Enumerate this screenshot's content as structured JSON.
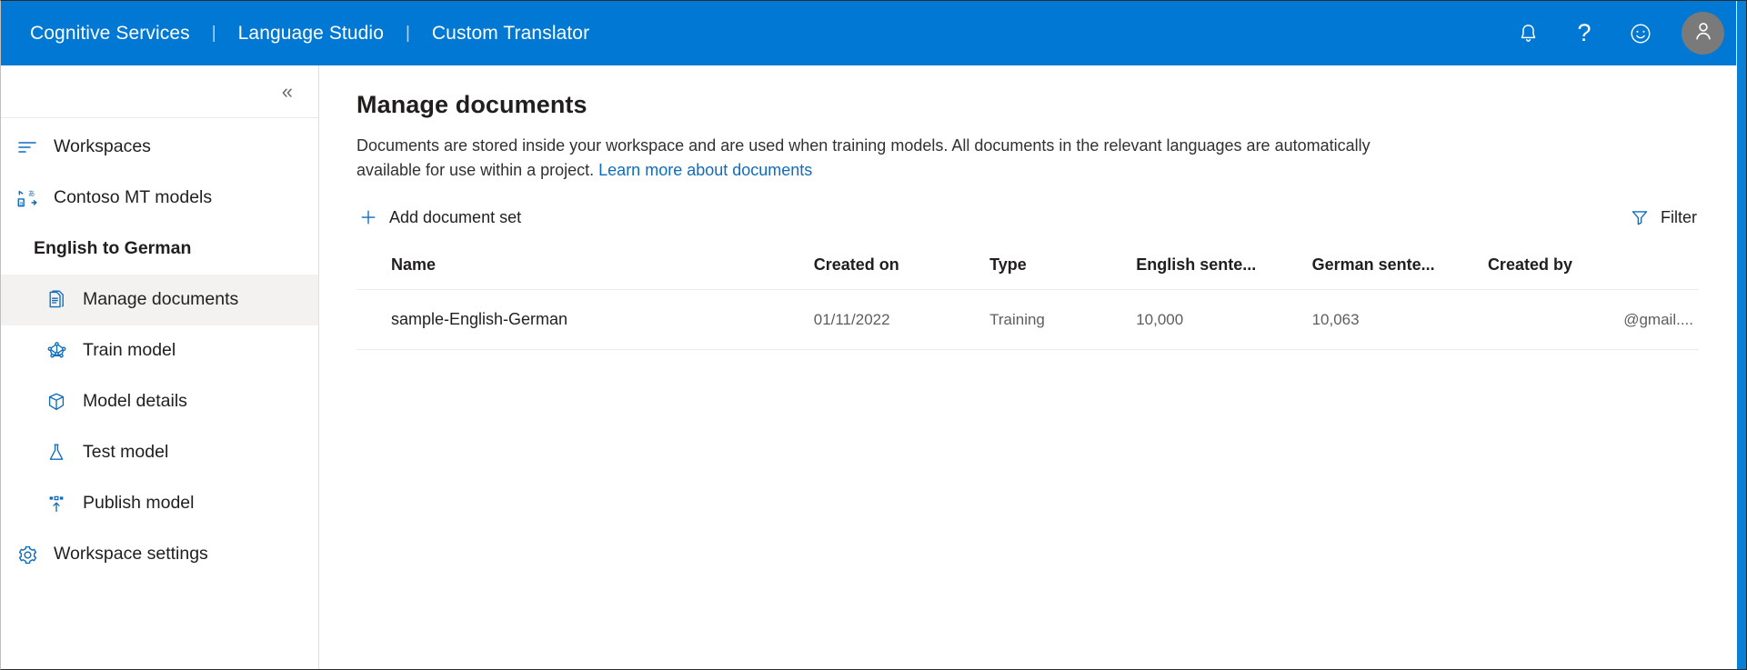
{
  "header": {
    "brand_items": [
      {
        "label": "Cognitive Services"
      },
      {
        "label": "Language Studio"
      },
      {
        "label": "Custom Translator"
      }
    ],
    "separator": "|",
    "icons": {
      "notifications": "bell-icon",
      "help": "?",
      "feedback": "smiley-icon",
      "account": "person-icon"
    },
    "colors": {
      "bar": "#0078d4",
      "text": "#ffffff",
      "avatar": "#7a7a7a"
    }
  },
  "sidebar": {
    "collapse_glyph": "«",
    "items": [
      {
        "label": "Workspaces",
        "icon": "list-icon",
        "level": "top",
        "selected": false
      },
      {
        "label": "Contoso MT models",
        "icon": "translate-icon",
        "level": "top",
        "selected": false
      },
      {
        "label": "English to German",
        "icon": "",
        "level": "group",
        "selected": false
      },
      {
        "label": "Manage documents",
        "icon": "document-icon",
        "level": "sub",
        "selected": true
      },
      {
        "label": "Train model",
        "icon": "network-icon",
        "level": "sub",
        "selected": false
      },
      {
        "label": "Model details",
        "icon": "package-icon",
        "level": "sub",
        "selected": false
      },
      {
        "label": "Test model",
        "icon": "flask-icon",
        "level": "sub",
        "selected": false
      },
      {
        "label": "Publish model",
        "icon": "publish-icon",
        "level": "sub",
        "selected": false
      },
      {
        "label": "Workspace settings",
        "icon": "gear-icon",
        "level": "top",
        "selected": false
      }
    ],
    "colors": {
      "selected_bg": "#f3f2f1",
      "icon": "#0f6cbd"
    }
  },
  "main": {
    "title": "Manage documents",
    "description_part1": "Documents are stored inside your workspace and are used when training models. All documents in the relevant languages are automatically available for use within a project. ",
    "description_link": "Learn more about documents",
    "toolbar": {
      "add_label": "Add document set",
      "add_icon": "plus-icon",
      "filter_label": "Filter",
      "filter_icon": "funnel-icon"
    },
    "table": {
      "columns": [
        "Name",
        "Created on",
        "Type",
        "English sente...",
        "German sente...",
        "Created by"
      ],
      "rows": [
        {
          "name": "sample-English-German",
          "created_on": "01/11/2022",
          "type": "Training",
          "english_sentences": "10,000",
          "german_sentences": "10,063",
          "created_by": "@gmail...."
        }
      ]
    }
  },
  "colors": {
    "accent": "#0078d4",
    "link": "#0f6cbd",
    "text_primary": "#201f1e",
    "text_secondary": "#605e5c",
    "divider": "#edebe9"
  }
}
